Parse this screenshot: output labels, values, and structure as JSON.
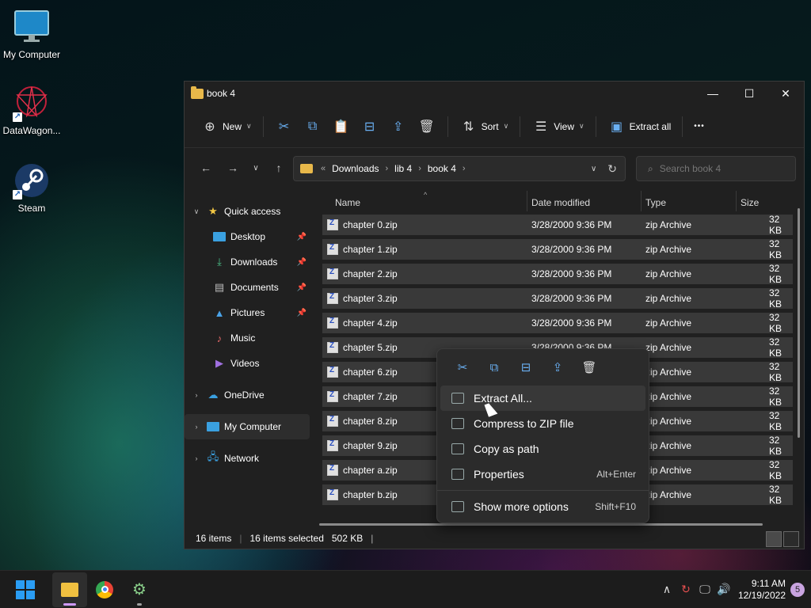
{
  "desktop": {
    "icons": [
      {
        "label": "My Computer",
        "icon": "monitor-icon"
      },
      {
        "label": "DataWagon...",
        "icon": "datawagon-icon"
      },
      {
        "label": "Steam",
        "icon": "steam-icon"
      }
    ]
  },
  "window": {
    "title": "book 4",
    "controls": {
      "minimize": "—",
      "maximize": "☐",
      "close": "✕"
    },
    "toolbar": {
      "new_label": "New",
      "sort_label": "Sort",
      "view_label": "View",
      "extract_label": "Extract all",
      "more_label": "•••"
    },
    "address": {
      "segments": [
        "Downloads",
        "lib 4",
        "book 4"
      ],
      "lead": "«"
    },
    "search": {
      "placeholder": "Search book 4"
    },
    "sidebar": {
      "quick_access": "Quick access",
      "items": [
        "Desktop",
        "Downloads",
        "Documents",
        "Pictures",
        "Music",
        "Videos"
      ],
      "onedrive": "OneDrive",
      "my_computer": "My Computer",
      "network": "Network"
    },
    "columns": {
      "name": "Name",
      "date": "Date modified",
      "type": "Type",
      "size": "Size"
    },
    "files": [
      {
        "name": "chapter 0.zip",
        "date": "3/28/2000 9:36 PM",
        "type": "zip Archive",
        "size": "32 KB"
      },
      {
        "name": "chapter 1.zip",
        "date": "3/28/2000 9:36 PM",
        "type": "zip Archive",
        "size": "32 KB"
      },
      {
        "name": "chapter 2.zip",
        "date": "3/28/2000 9:36 PM",
        "type": "zip Archive",
        "size": "32 KB"
      },
      {
        "name": "chapter 3.zip",
        "date": "3/28/2000 9:36 PM",
        "type": "zip Archive",
        "size": "32 KB"
      },
      {
        "name": "chapter 4.zip",
        "date": "3/28/2000 9:36 PM",
        "type": "zip Archive",
        "size": "32 KB"
      },
      {
        "name": "chapter 5.zip",
        "date": "3/28/2000 9:36 PM",
        "type": "zip Archive",
        "size": "32 KB"
      },
      {
        "name": "chapter 6.zip",
        "date": "",
        "type": "zip Archive",
        "size": "32 KB"
      },
      {
        "name": "chapter 7.zip",
        "date": "",
        "type": "zip Archive",
        "size": "32 KB"
      },
      {
        "name": "chapter 8.zip",
        "date": "",
        "type": "zip Archive",
        "size": "32 KB"
      },
      {
        "name": "chapter 9.zip",
        "date": "",
        "type": "zip Archive",
        "size": "32 KB"
      },
      {
        "name": "chapter a.zip",
        "date": "",
        "type": "zip Archive",
        "size": "32 KB"
      },
      {
        "name": "chapter b.zip",
        "date": "",
        "type": "zip Archive",
        "size": "32 KB"
      }
    ],
    "status": {
      "items": "16 items",
      "selected": "16 items selected",
      "size": "502 KB"
    }
  },
  "context_menu": {
    "icon_row": [
      "cut-icon",
      "copy-icon",
      "rename-icon",
      "share-icon",
      "delete-icon"
    ],
    "items": [
      {
        "label": "Extract All...",
        "shortcut": ""
      },
      {
        "label": "Compress to ZIP file",
        "shortcut": ""
      },
      {
        "label": "Copy as path",
        "shortcut": ""
      },
      {
        "label": "Properties",
        "shortcut": "Alt+Enter"
      },
      {
        "label": "Show more options",
        "shortcut": "Shift+F10"
      }
    ]
  },
  "taskbar": {
    "time": "9:11 AM",
    "date": "12/19/2022",
    "badge": "5"
  }
}
